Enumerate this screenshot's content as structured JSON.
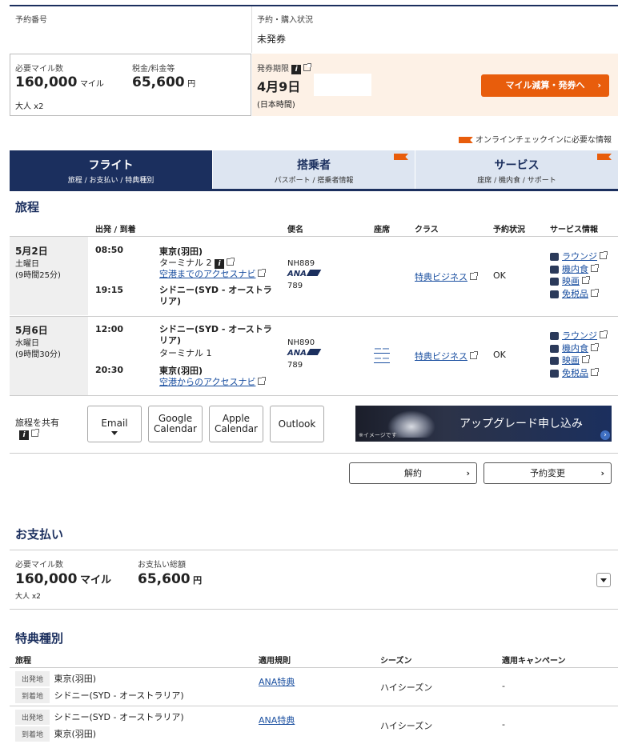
{
  "summary": {
    "booking_number_label": "予約番号",
    "status_label": "予約・購入状況",
    "status_value": "未発券",
    "miles_label": "必要マイル数",
    "miles_value": "160,000",
    "miles_unit": "マイル",
    "tax_label": "税金/料金等",
    "tax_value": "65,600",
    "tax_unit": "円",
    "pax": "大人 x2",
    "deadline_label": "発券期限",
    "deadline_value": "4月9日",
    "deadline_note": "(日本時間)",
    "issue_button": "マイル減算・発券へ"
  },
  "checkin_note": "オンラインチェックインに必要な情報",
  "tabs": [
    {
      "title": "フライト",
      "sub": "旅程 / お支払い / 特典種別",
      "active": true
    },
    {
      "title": "搭乗者",
      "sub": "パスポート / 搭乗者情報",
      "active": false
    },
    {
      "title": "サービス",
      "sub": "座席 / 機内食 / サポート",
      "active": false
    }
  ],
  "itinerary": {
    "heading": "旅程",
    "columns": {
      "dep_arr": "出発 / 到着",
      "flight": "便名",
      "seat": "座席",
      "class": "クラス",
      "status": "予約状況",
      "services": "サービス情報"
    },
    "segments": [
      {
        "date": "5月2日",
        "weekday": "土曜日",
        "duration": "(9時間25分)",
        "dep_time": "08:50",
        "dep_place": "東京(羽田)",
        "terminal": "ターミナル 2",
        "access": "空港までのアクセスナビ",
        "arr_time": "19:15",
        "arr_place": "シドニー(SYD - オーストラリア)",
        "flight": "NH889",
        "carrier": "ANA",
        "aircraft": "789",
        "seat": "",
        "class": "特典ビジネス",
        "status": "OK",
        "services": [
          "ラウンジ",
          "機内食",
          "映画",
          "免税品"
        ]
      },
      {
        "date": "5月6日",
        "weekday": "水曜日",
        "duration": "(9時間30分)",
        "dep_time": "12:00",
        "dep_place": "シドニー(SYD - オーストラリア)",
        "terminal": "ターミナル 1",
        "access": "",
        "arr_time": "20:30",
        "arr_place": "東京(羽田)",
        "arr_access": "空港からのアクセスナビ",
        "flight": "NH890",
        "carrier": "ANA",
        "aircraft": "789",
        "seat": "ーー",
        "class": "特典ビジネス",
        "status": "OK",
        "services": [
          "ラウンジ",
          "機内食",
          "映画",
          "免税品"
        ]
      }
    ],
    "share_label": "旅程を共有",
    "share_buttons": [
      "Email",
      "Google Calendar",
      "Apple Calendar",
      "Outlook"
    ],
    "upgrade_banner": "アップグレード申し込み",
    "upgrade_note": "※イメージです",
    "cancel_button": "解約",
    "change_button": "予約変更"
  },
  "payment": {
    "heading": "お支払い",
    "miles_label": "必要マイル数",
    "miles_value": "160,000",
    "miles_unit": "マイル",
    "total_label": "お支払い総額",
    "total_value": "65,600",
    "total_unit": "円",
    "pax": "大人 x2"
  },
  "award": {
    "heading": "特典種別",
    "columns": {
      "route": "旅程",
      "rule": "適用規則",
      "season": "シーズン",
      "campaign": "適用キャンペーン"
    },
    "dep_tag": "出発地",
    "arr_tag": "到着地",
    "rows": [
      {
        "from": "東京(羽田)",
        "to": "シドニー(SYD - オーストラリア)",
        "rule": "ANA特典",
        "season": "ハイシーズン",
        "campaign": "-"
      },
      {
        "from": "シドニー(SYD - オーストラリア)",
        "to": "東京(羽田)",
        "rule": "ANA特典",
        "season": "ハイシーズン",
        "campaign": "-"
      }
    ]
  },
  "colors": {
    "navy": "#1b2f5e",
    "orange": "#e85d0c",
    "peach": "#fdf1e6",
    "tab_inactive": "#dde5f1",
    "row_gray": "#efefef"
  }
}
